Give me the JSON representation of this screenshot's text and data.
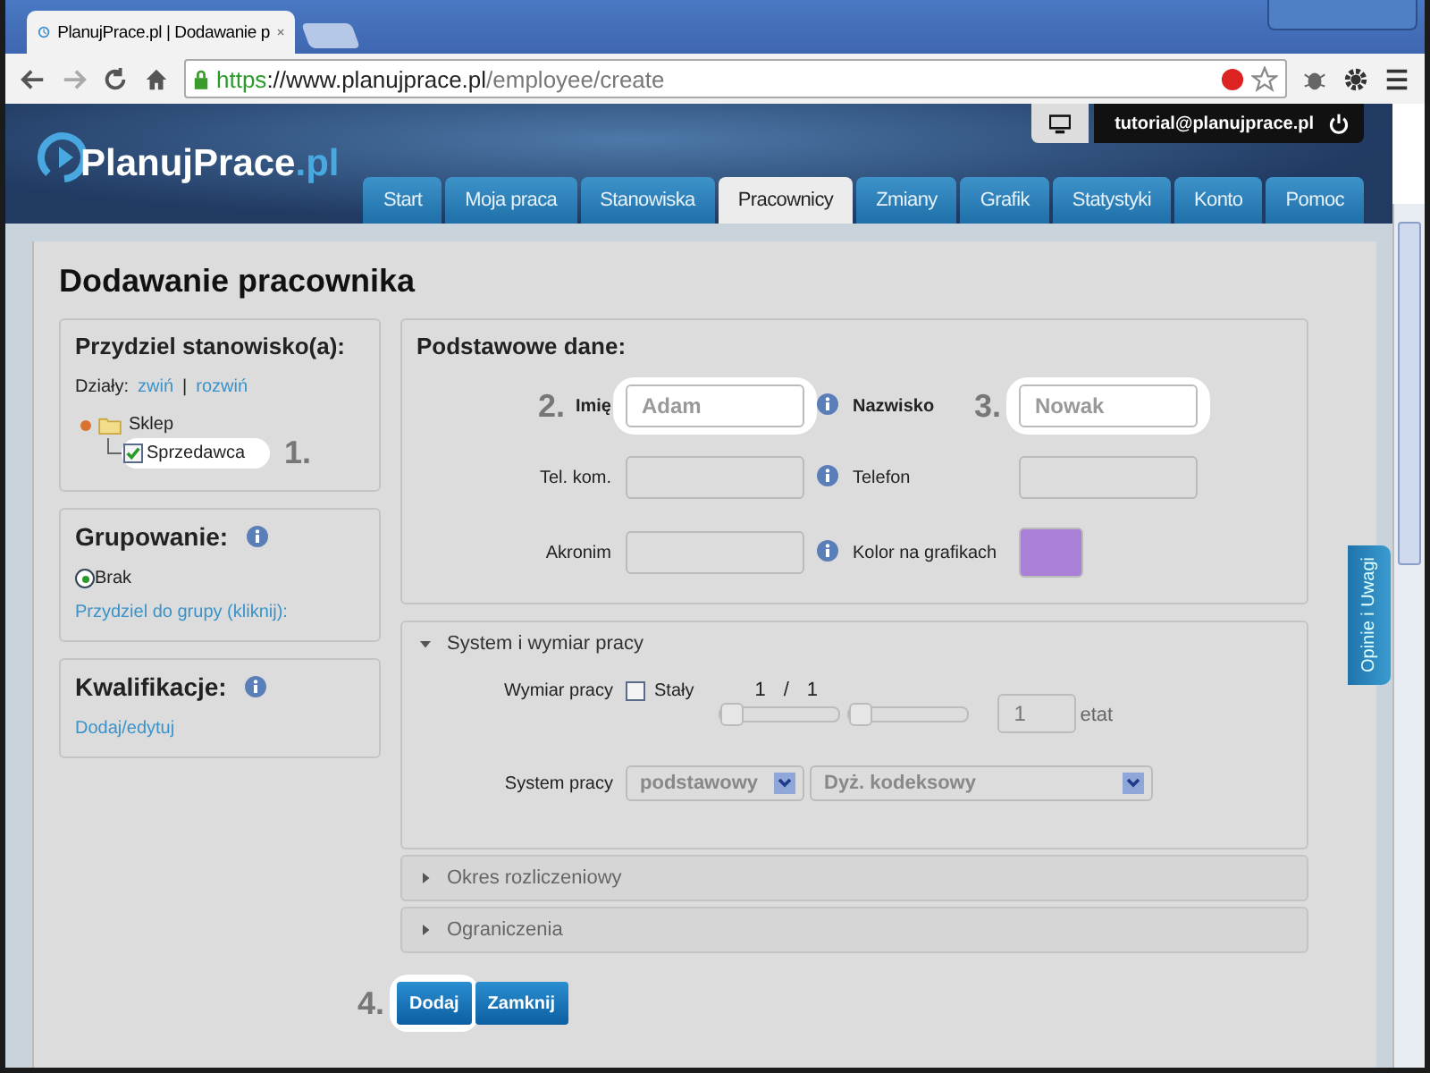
{
  "browser": {
    "tab_title": "PlanujPrace.pl | Dodawanie p",
    "url": {
      "scheme": "https",
      "host": "://www.planujprace.pl",
      "path": "/employee/create"
    }
  },
  "header": {
    "logo": "PlanujPrace",
    "logo_suffix": ".pl",
    "user": "tutorial@planujprace.pl"
  },
  "nav": [
    {
      "label": "Start",
      "selected": false
    },
    {
      "label": "Moja praca",
      "selected": false
    },
    {
      "label": "Stanowiska",
      "selected": false
    },
    {
      "label": "Pracownicy",
      "selected": true
    },
    {
      "label": "Zmiany",
      "selected": false
    },
    {
      "label": "Grafik",
      "selected": false
    },
    {
      "label": "Statystyki",
      "selected": false
    },
    {
      "label": "Konto",
      "selected": false
    },
    {
      "label": "Pomoc",
      "selected": false
    }
  ],
  "page_title": "Dodawanie pracownika",
  "assign": {
    "title": "Przydziel stanowisko(a):",
    "label": "Działy:",
    "collapse": "zwiń",
    "separator": "|",
    "expand": "rozwiń",
    "tree": [
      {
        "label": "Sklep",
        "children": [
          {
            "label": "Sprzedawca",
            "checked": true,
            "highlighted": true,
            "callout": "1."
          }
        ]
      }
    ]
  },
  "grouping": {
    "title": "Grupowanie:",
    "options": [
      {
        "label": "Brak",
        "selected": true
      }
    ],
    "link": "Przydziel do grupy (kliknij):"
  },
  "qualifications": {
    "title": "Kwalifikacje:",
    "link": "Dodaj/edytuj"
  },
  "basic": {
    "title": "Podstawowe dane:",
    "rows": [
      {
        "left": {
          "label": "Imię",
          "required": true,
          "placeholder": "Adam",
          "highlighted": true,
          "callout": "2.",
          "info": true
        },
        "right": {
          "kind": "text",
          "label": "Nazwisko",
          "required": true,
          "placeholder": "Nowak",
          "highlighted": true,
          "callout": "3."
        }
      },
      {
        "left": {
          "label": "Tel. kom.",
          "required": false,
          "highlighted": false,
          "info": true
        },
        "right": {
          "kind": "text",
          "label": "Telefon",
          "required": false,
          "highlighted": false
        }
      },
      {
        "left": {
          "label": "Akronim",
          "required": false,
          "highlighted": false,
          "info": true
        },
        "right": {
          "kind": "color",
          "label": "Kolor na grafikach",
          "required": false,
          "highlighted": false,
          "color": "#a97fd8"
        }
      }
    ]
  },
  "sections": [
    {
      "title": "System i wymiar pracy",
      "expanded": true
    },
    {
      "title": "Okres rozliczeniowy",
      "expanded": false
    },
    {
      "title": "Ograniczenia",
      "expanded": false
    }
  ],
  "work": {
    "label": "Wymiar pracy",
    "fixed": {
      "label": "Stały",
      "checked": false
    },
    "numerator": "1",
    "slash": "/",
    "denominator": "1",
    "sliders": [
      {
        "level": 0
      },
      {
        "level": 0
      }
    ],
    "fte": "1",
    "fte_unit": "etat",
    "system_label": "System pracy",
    "system": "podstawowy",
    "schedule": "Dyż. kodeksowy"
  },
  "actions": {
    "callout": "4.",
    "buttons": [
      {
        "label": "Dodaj",
        "highlighted": true
      },
      {
        "label": "Zamknij",
        "highlighted": false
      }
    ]
  },
  "feedback": "Opinie i Uwagi"
}
